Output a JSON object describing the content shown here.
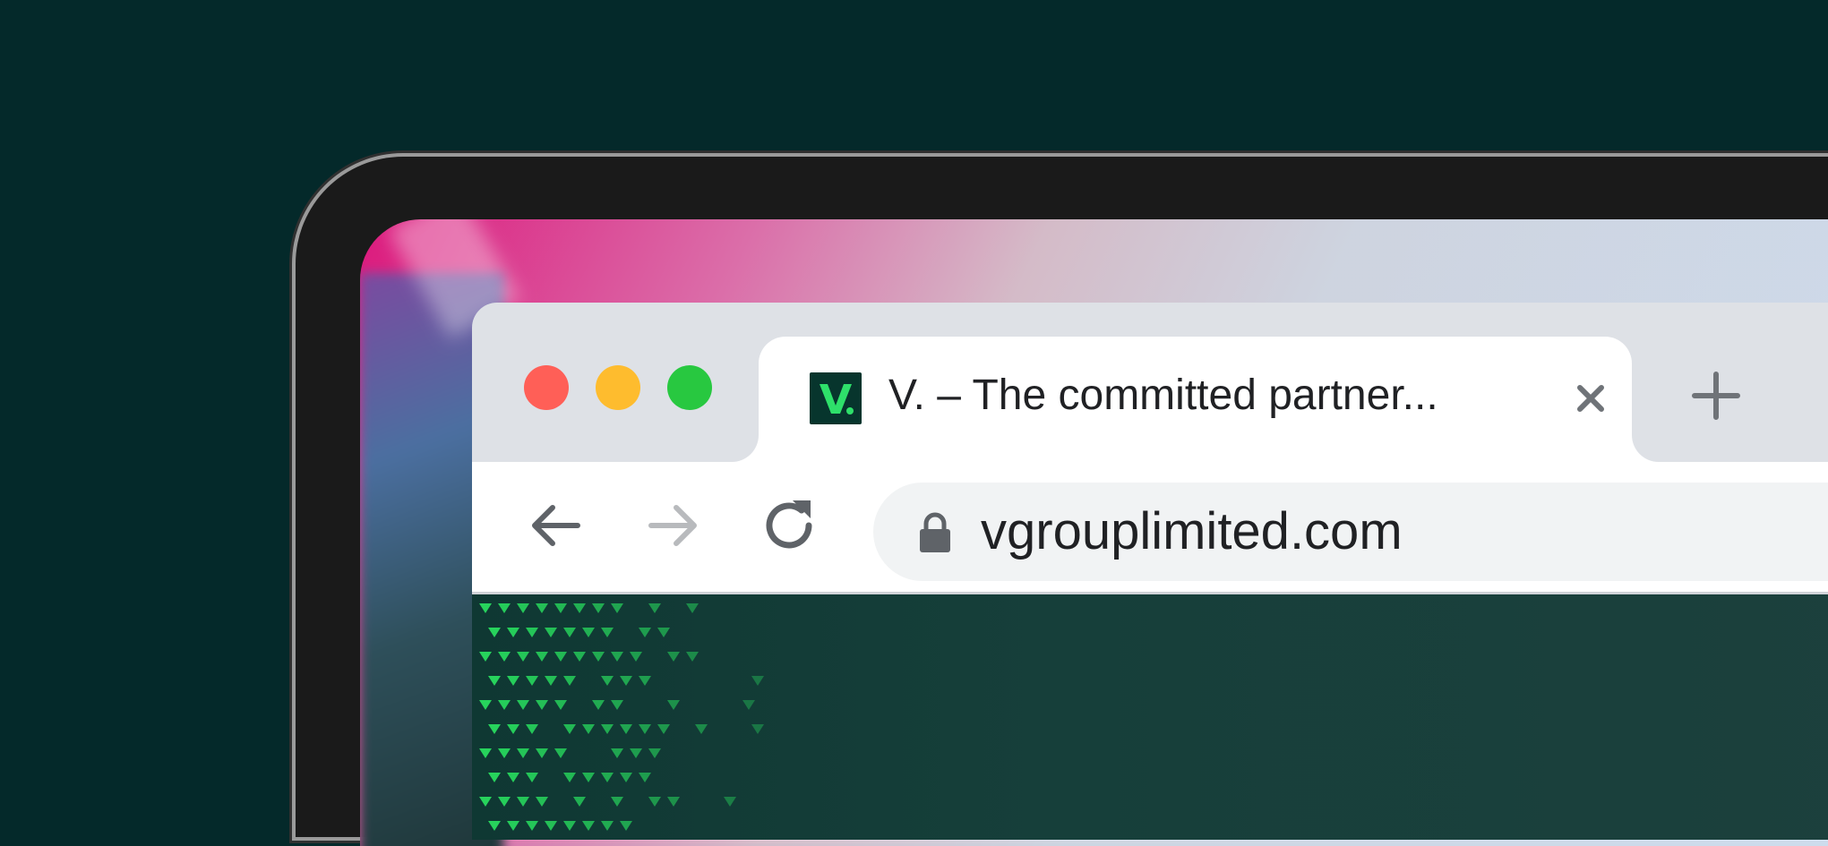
{
  "browser": {
    "tab": {
      "title": "V. – The committed partner...",
      "favicon_icon": "v-logo-icon",
      "close_icon": "close-icon"
    },
    "new_tab_icon": "plus-icon",
    "toolbar": {
      "back_icon": "arrow-left-icon",
      "forward_icon": "arrow-right-icon",
      "reload_icon": "reload-icon"
    },
    "omnibox": {
      "lock_icon": "lock-icon",
      "url": "vgrouplimited.com"
    }
  },
  "colors": {
    "background": "#04292a",
    "accent_green": "#27d35c",
    "traffic_red": "#ff5f57",
    "traffic_yellow": "#febc2e",
    "traffic_green": "#28c840"
  }
}
